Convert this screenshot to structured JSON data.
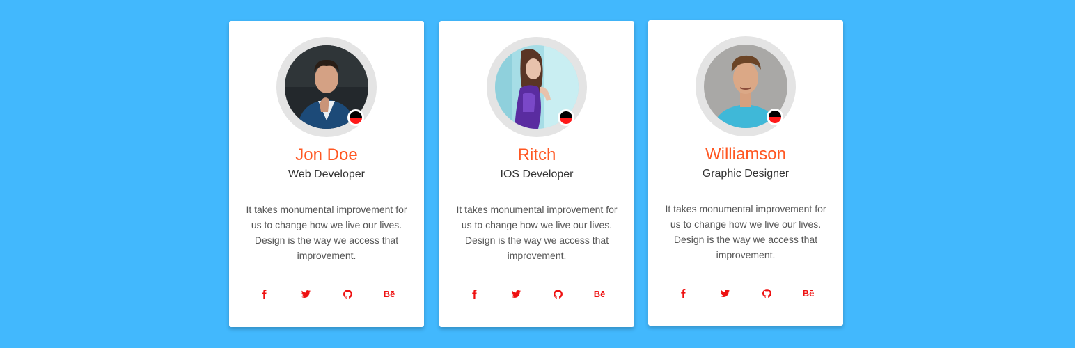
{
  "colors": {
    "background": "#42b8fd",
    "name_accent": "#ff5722",
    "social_icon": "#ee1111",
    "status_top": "#000000",
    "status_bottom": "#ff1a1a"
  },
  "cards": [
    {
      "name": "Jon Doe",
      "role": "Web Developer",
      "bio": "It takes monumental improvement for us to change how we live our lives. Design is the way we access that improvement.",
      "avatar_icon": "profile-photo-man-in-suit",
      "social": [
        {
          "icon": "facebook-icon"
        },
        {
          "icon": "twitter-icon"
        },
        {
          "icon": "github-icon"
        },
        {
          "icon": "behance-icon",
          "label": "Bē"
        }
      ]
    },
    {
      "name": "Ritch",
      "role": "IOS Developer",
      "bio": "It takes monumental improvement for us to change how we live our lives. Design is the way we access that improvement.",
      "avatar_icon": "profile-photo-woman-purple-dress",
      "social": [
        {
          "icon": "facebook-icon"
        },
        {
          "icon": "twitter-icon"
        },
        {
          "icon": "github-icon"
        },
        {
          "icon": "behance-icon",
          "label": "Bē"
        }
      ]
    },
    {
      "name": "Williamson",
      "role": "Graphic Designer",
      "bio": "It takes monumental improvement for us to change how we live our lives. Design is the way we access that improvement.",
      "avatar_icon": "profile-photo-man-blue-tshirt",
      "social": [
        {
          "icon": "facebook-icon"
        },
        {
          "icon": "twitter-icon"
        },
        {
          "icon": "github-icon"
        },
        {
          "icon": "behance-icon",
          "label": "Bē"
        }
      ]
    }
  ]
}
